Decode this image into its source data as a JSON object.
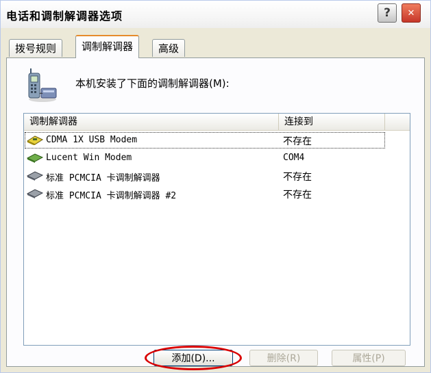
{
  "window": {
    "title": "电话和调制解调器选项"
  },
  "title_buttons": {
    "help_label": "?",
    "close_label": "✕"
  },
  "tabs": [
    {
      "label": "拨号规则",
      "active": false
    },
    {
      "label": "调制解调器",
      "active": true
    },
    {
      "label": "高级",
      "active": false
    }
  ],
  "panel": {
    "icon": "phone-modem-icon",
    "description": "本机安装了下面的调制解调器(M):"
  },
  "listview": {
    "columns": [
      "调制解调器",
      "连接到"
    ],
    "rows": [
      {
        "name": "CDMA 1X USB Modem",
        "port": "不存在",
        "icon": "usb-modem-icon",
        "focused": true
      },
      {
        "name": "Lucent Win Modem",
        "port": "COM4",
        "icon": "modem-icon",
        "focused": false
      },
      {
        "name": "标准 PCMCIA 卡调制解调器",
        "port": "不存在",
        "icon": "modem-icon",
        "focused": false
      },
      {
        "name": "标准 PCMCIA 卡调制解调器 #2",
        "port": "不存在",
        "icon": "modem-icon",
        "focused": false
      }
    ]
  },
  "buttons": {
    "add": "添加(D)...",
    "remove": "删除(R)",
    "properties": "属性(P)"
  },
  "colors": {
    "annotation": "#d90000",
    "active_tab_accent": "#e68b2c",
    "close_button": "#c6372a"
  }
}
